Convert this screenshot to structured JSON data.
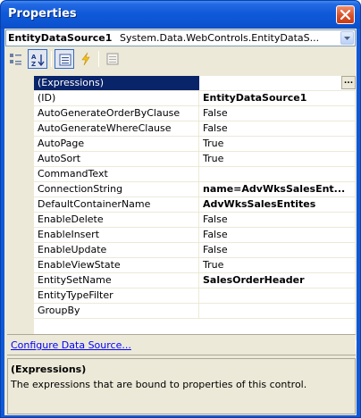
{
  "window": {
    "title": "Properties"
  },
  "object_selector": {
    "name": "EntityDataSource1",
    "type": "System.Data.WebControls.EntityDataS..."
  },
  "toolbar": {
    "buttons": [
      {
        "icon": "categorized-icon",
        "active": false
      },
      {
        "icon": "alphabetical-icon",
        "active": true
      },
      {
        "icon": "properties-icon",
        "active": true
      },
      {
        "icon": "events-icon",
        "active": false
      },
      {
        "icon": "property-pages-icon",
        "active": false
      }
    ]
  },
  "properties": [
    {
      "name": "(Expressions)",
      "value": "",
      "bold": false,
      "selected": true,
      "has_ellipsis": true,
      "ellipsis": "..."
    },
    {
      "name": "(ID)",
      "value": "EntityDataSource1",
      "bold": true
    },
    {
      "name": "AutoGenerateOrderByClause",
      "value": "False",
      "bold": false
    },
    {
      "name": "AutoGenerateWhereClause",
      "value": "False",
      "bold": false
    },
    {
      "name": "AutoPage",
      "value": "True",
      "bold": false
    },
    {
      "name": "AutoSort",
      "value": "True",
      "bold": false
    },
    {
      "name": "CommandText",
      "value": "",
      "bold": false
    },
    {
      "name": "ConnectionString",
      "value": "name=AdvWksSalesEnt...",
      "bold": true
    },
    {
      "name": "DefaultContainerName",
      "value": "AdvWksSalesEntites",
      "bold": true
    },
    {
      "name": "EnableDelete",
      "value": "False",
      "bold": false
    },
    {
      "name": "EnableInsert",
      "value": "False",
      "bold": false
    },
    {
      "name": "EnableUpdate",
      "value": "False",
      "bold": false
    },
    {
      "name": "EnableViewState",
      "value": "True",
      "bold": false
    },
    {
      "name": "EntitySetName",
      "value": "SalesOrderHeader",
      "bold": true
    },
    {
      "name": "EntityTypeFilter",
      "value": "",
      "bold": false
    },
    {
      "name": "GroupBy",
      "value": "",
      "bold": false
    }
  ],
  "commands": {
    "configure_link": "Configure Data Source..."
  },
  "description": {
    "title": "(Expressions)",
    "text": "The expressions that are bound to properties of this control."
  }
}
